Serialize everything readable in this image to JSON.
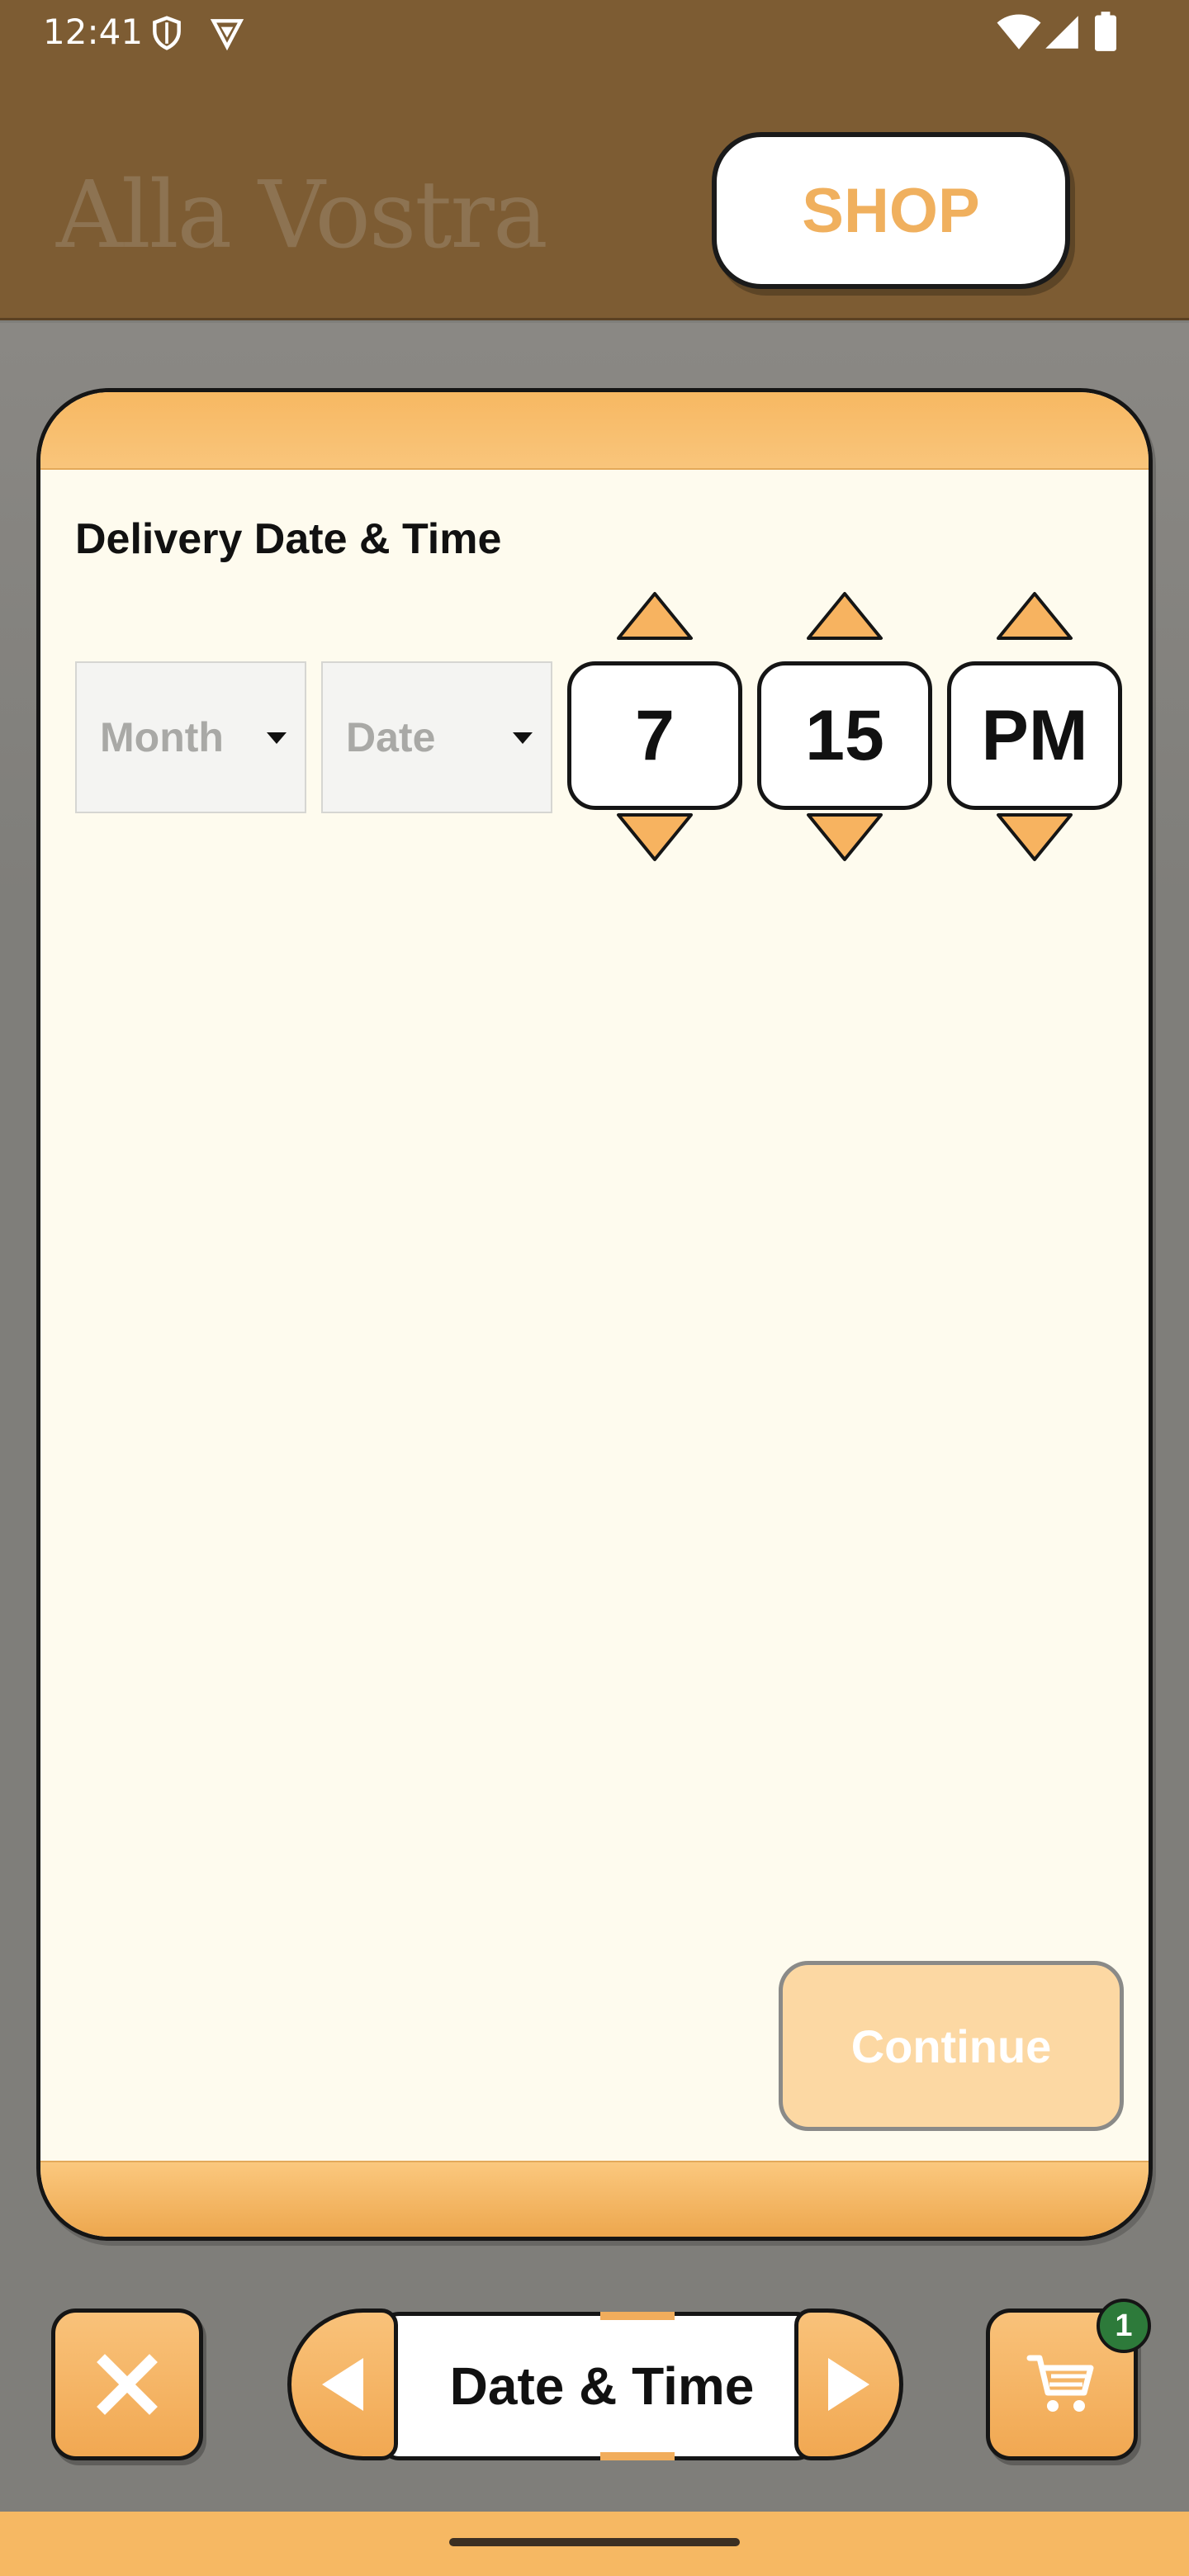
{
  "status_bar": {
    "time": "12:41",
    "left_icons": [
      "shield-icon",
      "vpn-icon"
    ],
    "right_icons": [
      "wifi-icon",
      "signal-icon",
      "battery-icon"
    ]
  },
  "header": {
    "brand": "Alla Vostra",
    "shop_label": "SHOP"
  },
  "card": {
    "section_title": "Delivery Date & Time",
    "month_placeholder": "Month",
    "date_placeholder": "Date",
    "hour": "7",
    "minute": "15",
    "meridiem": "PM",
    "continue_label": "Continue"
  },
  "bottom_nav": {
    "close_icon": "close-icon",
    "prev_icon": "chevron-left-icon",
    "step_label": "Date & Time",
    "next_icon": "chevron-right-icon",
    "cart_icon": "cart-icon",
    "cart_count": "1"
  },
  "colors": {
    "header_brown": "#7d5c33",
    "accent_orange": "#f1a852",
    "shop_text": "#f0b05e",
    "card_bg": "#fefbee",
    "continue_disabled": "#fcd8a3",
    "badge_green": "#2d7a3a"
  }
}
